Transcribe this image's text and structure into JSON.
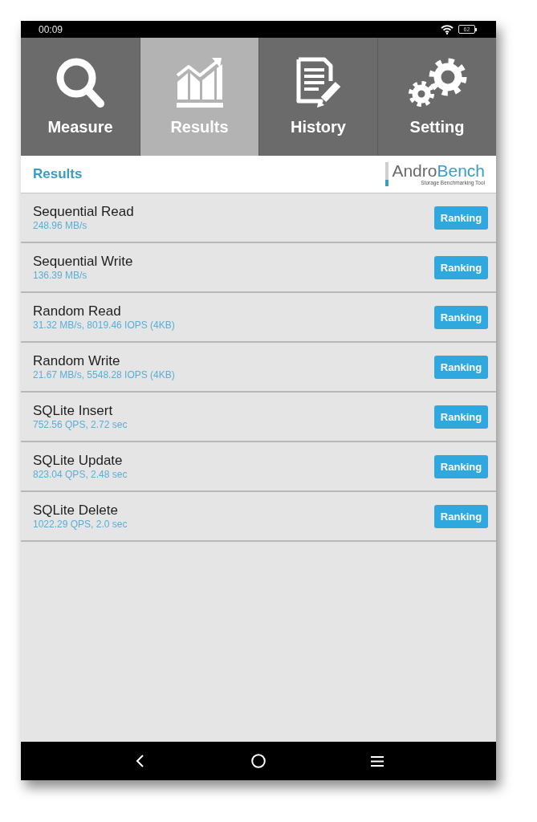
{
  "status_bar": {
    "time": "00:09",
    "battery": "62"
  },
  "tabs": [
    {
      "label": "Measure",
      "selected": false
    },
    {
      "label": "Results",
      "selected": true
    },
    {
      "label": "History",
      "selected": false
    },
    {
      "label": "Setting",
      "selected": false
    }
  ],
  "header": {
    "title": "Results",
    "logo": {
      "wordmark": [
        "Andro",
        "Bench"
      ],
      "tagline": "Storage Benchmarking Tool"
    }
  },
  "results": [
    {
      "name": "Sequential Read",
      "value": "248.96 MB/s",
      "button": "Ranking"
    },
    {
      "name": "Sequential Write",
      "value": "136.39 MB/s",
      "button": "Ranking"
    },
    {
      "name": "Random Read",
      "value": "31.32 MB/s, 8019.46 IOPS (4KB)",
      "button": "Ranking"
    },
    {
      "name": "Random Write",
      "value": "21.67 MB/s, 5548.28 IOPS (4KB)",
      "button": "Ranking"
    },
    {
      "name": "SQLite Insert",
      "value": "752.56 QPS, 2.72 sec",
      "button": "Ranking"
    },
    {
      "name": "SQLite Update",
      "value": "823.04 QPS, 2.48 sec",
      "button": "Ranking"
    },
    {
      "name": "SQLite Delete",
      "value": "1022.29 QPS, 2.0 sec",
      "button": "Ranking"
    }
  ]
}
